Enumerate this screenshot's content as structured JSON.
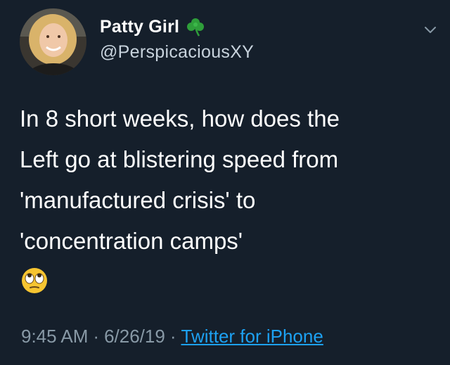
{
  "tweet": {
    "author": {
      "display_name": "Patty Girl",
      "name_emoji": "shamrock-icon",
      "handle": "@PerspicaciousXY"
    },
    "text_lines": [
      "In 8 short weeks, how does the",
      "Left go at blistering speed from",
      "'manufactured crisis' to",
      "'concentration camps'"
    ],
    "reaction_emoji": "face-with-rolling-eyes-icon",
    "time": "9:45 AM",
    "date": "6/26/19",
    "separator": "·",
    "source": "Twitter for iPhone"
  },
  "colors": {
    "background": "#151f2b",
    "text": "#ffffff",
    "secondary_text": "#8899a6",
    "link": "#1da1f2",
    "clover": "#2e9e3a"
  }
}
